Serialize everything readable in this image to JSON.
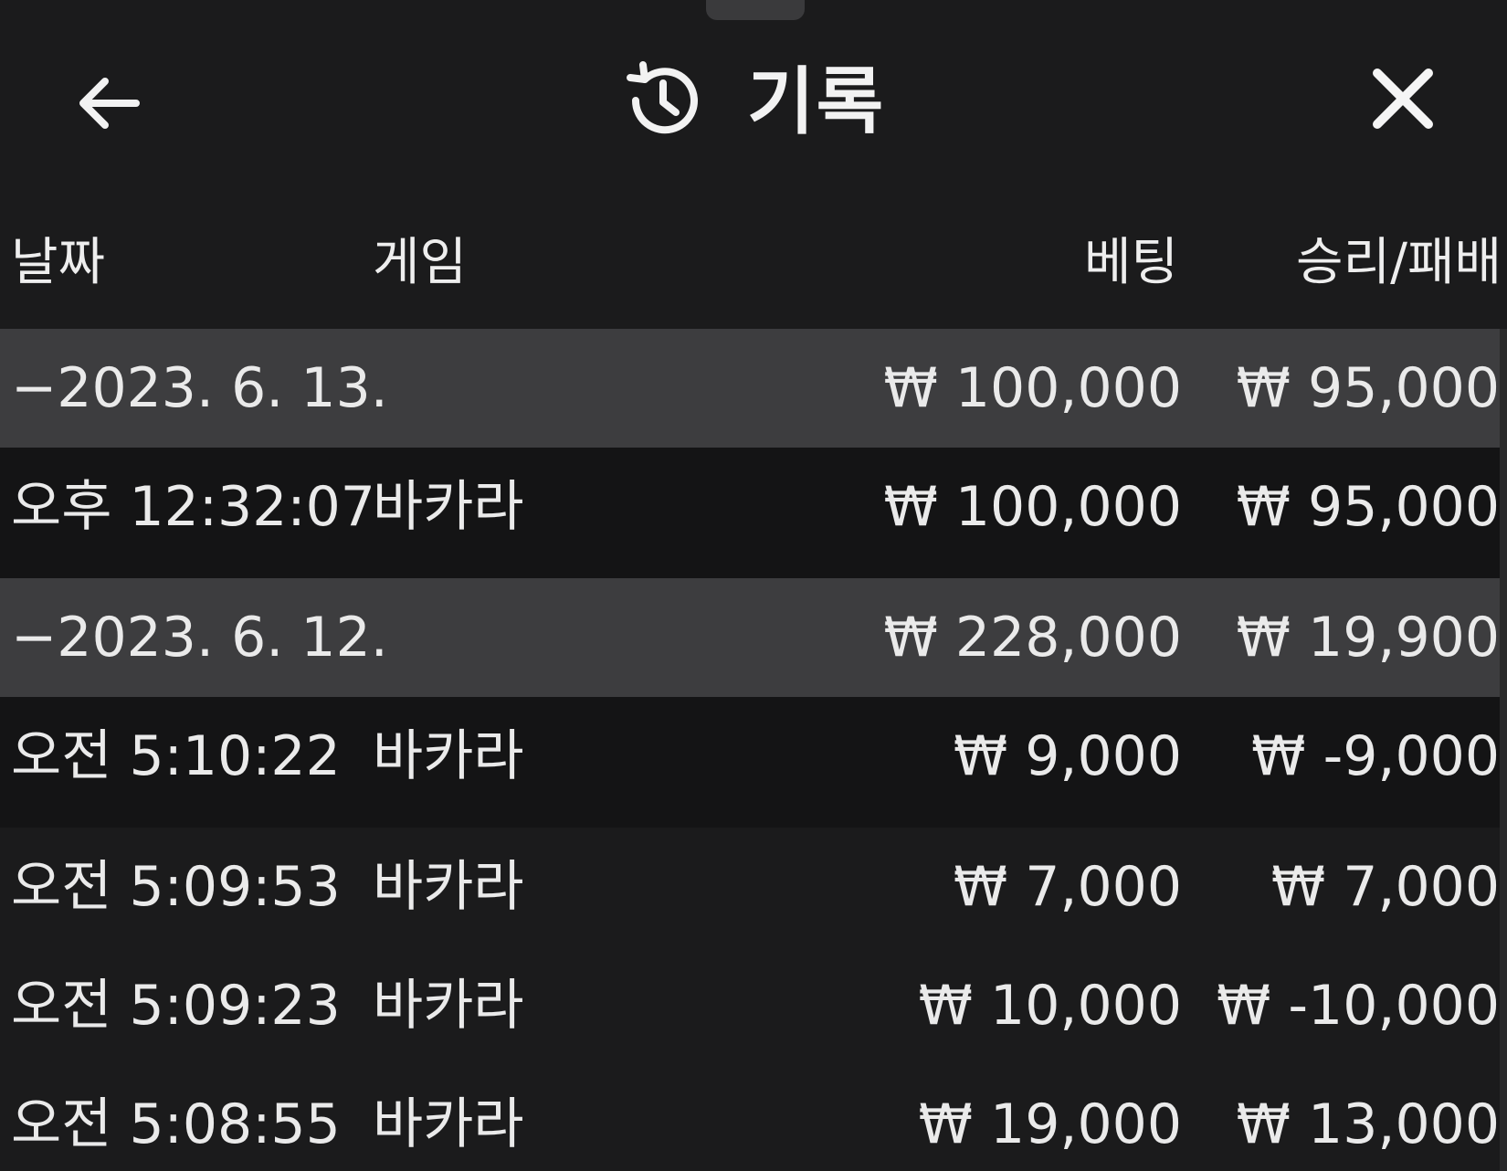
{
  "header": {
    "title": "기록",
    "back_icon": "arrow-left-icon",
    "history_icon": "history-clock-icon",
    "close_icon": "close-icon"
  },
  "columns": {
    "date": "날짜",
    "game": "게임",
    "bet": "베팅",
    "result": "승리/패배"
  },
  "groups": [
    {
      "date": "−2023. 6. 13.",
      "bet": "₩ 100,000",
      "result": "₩ 95,000",
      "items": [
        {
          "time": "오후 12:32:07",
          "game": "바카라",
          "bet": "₩ 100,000",
          "result": "₩ 95,000"
        }
      ]
    },
    {
      "date": "−2023. 6. 12.",
      "bet": "₩ 228,000",
      "result": "₩ 19,900",
      "items": [
        {
          "time": "오전 5:10:22",
          "game": "바카라",
          "bet": "₩ 9,000",
          "result": "₩ -9,000"
        },
        {
          "time": "오전 5:09:53",
          "game": "바카라",
          "bet": "₩ 7,000",
          "result": "₩ 7,000"
        },
        {
          "time": "오전 5:09:23",
          "game": "바카라",
          "bet": "₩ 10,000",
          "result": "₩ -10,000"
        },
        {
          "time": "오전 5:08:55",
          "game": "바카라",
          "bet": "₩ 19,000",
          "result": "₩ 13,000"
        }
      ]
    }
  ],
  "colors": {
    "background": "#1b1b1c",
    "group_row": "#3d3d3f",
    "item_row_highlight": "#141415",
    "text": "#eaeaea"
  }
}
